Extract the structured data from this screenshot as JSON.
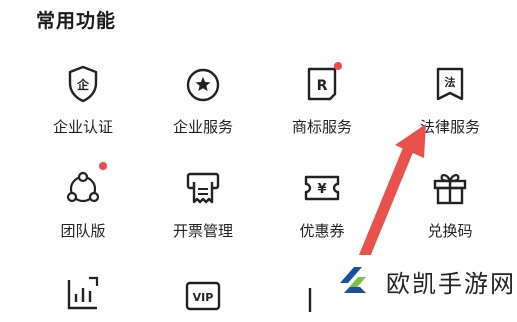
{
  "section": {
    "title": "常用功能"
  },
  "items": [
    {
      "label": "企业认证",
      "icon": "enterprise-cert-icon",
      "badge": false
    },
    {
      "label": "企业服务",
      "icon": "enterprise-service-icon",
      "badge": false
    },
    {
      "label": "商标服务",
      "icon": "trademark-icon",
      "badge": true
    },
    {
      "label": "法律服务",
      "icon": "legal-icon",
      "badge": false
    },
    {
      "label": "团队版",
      "icon": "team-icon",
      "badge": true
    },
    {
      "label": "开票管理",
      "icon": "invoice-icon",
      "badge": false
    },
    {
      "label": "优惠券",
      "icon": "coupon-icon",
      "badge": false
    },
    {
      "label": "兑换码",
      "icon": "gift-icon",
      "badge": false
    }
  ],
  "glyphs": {
    "enterprise": "企",
    "trademark": "R",
    "legal": "法",
    "coupon": "¥",
    "vip": "VIP"
  },
  "watermark": {
    "text": "欧凯手游网"
  },
  "colors": {
    "badge": "#f0494b",
    "arrow": "#e8524a",
    "watermark_blue": "#1b4fa0",
    "watermark_green": "#7cc242"
  }
}
